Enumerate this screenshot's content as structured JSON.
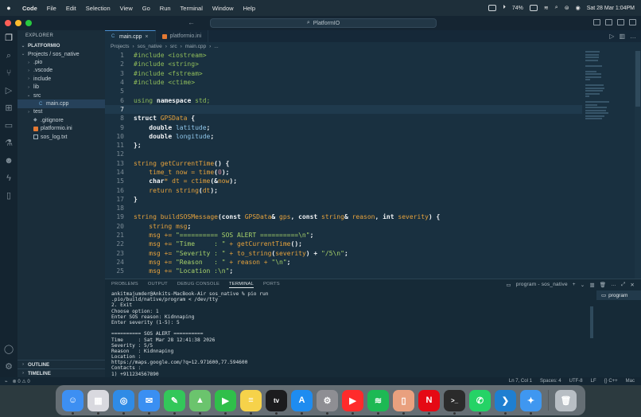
{
  "menubar": {
    "apple": "",
    "items": [
      "Code",
      "File",
      "Edit",
      "Selection",
      "View",
      "Go",
      "Run",
      "Terminal",
      "Window",
      "Help"
    ],
    "battery": "74%",
    "datetime": "Sat 28 Mar  1:04PM"
  },
  "titlebar": {
    "nav": "← →",
    "search": "PlatformIO"
  },
  "sidebar": {
    "header": "EXPLORER",
    "root": "PLATFORMIO",
    "tree": [
      {
        "label": "Projects / sos_native",
        "depth": 0,
        "chevron": "⌄",
        "icon": ""
      },
      {
        "label": ".pio",
        "depth": 1,
        "chevron": "›",
        "icon": ""
      },
      {
        "label": ".vscode",
        "depth": 1,
        "chevron": "›",
        "icon": ""
      },
      {
        "label": "include",
        "depth": 1,
        "chevron": "›",
        "icon": ""
      },
      {
        "label": "lib",
        "depth": 1,
        "chevron": "›",
        "icon": ""
      },
      {
        "label": "src",
        "depth": 1,
        "chevron": "⌄",
        "icon": ""
      },
      {
        "label": "main.cpp",
        "depth": 2,
        "chevron": "",
        "icon": "cpp"
      },
      {
        "label": "test",
        "depth": 1,
        "chevron": "›",
        "icon": ""
      },
      {
        "label": ".gitignore",
        "depth": 1,
        "chevron": "",
        "icon": "git"
      },
      {
        "label": "platformio.ini",
        "depth": 1,
        "chevron": "",
        "icon": "ini"
      },
      {
        "label": "sos_log.txt",
        "depth": 1,
        "chevron": "",
        "icon": "txt"
      }
    ],
    "outline": "OUTLINE",
    "timeline": "TIMELINE"
  },
  "editor": {
    "tabs": [
      {
        "label": "main.cpp",
        "active": true
      },
      {
        "label": "platformio.ini",
        "active": false
      }
    ],
    "breadcrumb": [
      "Projects",
      "sos_native",
      "src",
      "main.cpp",
      "..."
    ],
    "current_line": 7,
    "lines": [
      {
        "n": "1",
        "segs": [
          [
            "pp",
            "#include <iostream>"
          ]
        ]
      },
      {
        "n": "2",
        "segs": [
          [
            "pp",
            "#include <string>"
          ]
        ]
      },
      {
        "n": "3",
        "segs": [
          [
            "pp",
            "#include <fstream>"
          ]
        ]
      },
      {
        "n": "4",
        "segs": [
          [
            "pp",
            "#include <ctime>"
          ]
        ]
      },
      {
        "n": "5",
        "segs": []
      },
      {
        "n": "6",
        "segs": [
          [
            "pp",
            "using "
          ],
          [
            "kw",
            "namespace"
          ],
          [
            "pp",
            " std;"
          ]
        ]
      },
      {
        "n": "7",
        "segs": []
      },
      {
        "n": "8",
        "segs": [
          [
            "kw",
            "struct "
          ],
          [
            "ty",
            "GPSData"
          ],
          [
            "kw",
            " {"
          ]
        ]
      },
      {
        "n": "9",
        "segs": [
          [
            "kw",
            "    double "
          ],
          [
            "var",
            "latitude"
          ],
          [
            "kw",
            ";"
          ]
        ]
      },
      {
        "n": "10",
        "segs": [
          [
            "kw",
            "    double "
          ],
          [
            "var",
            "longitude"
          ],
          [
            "kw",
            ";"
          ]
        ]
      },
      {
        "n": "11",
        "segs": [
          [
            "kw",
            "};"
          ]
        ]
      },
      {
        "n": "12",
        "segs": []
      },
      {
        "n": "13",
        "segs": [
          [
            "fn",
            "string getCurrentTime"
          ],
          [
            "kw",
            "() {"
          ]
        ]
      },
      {
        "n": "14",
        "segs": [
          [
            "fn",
            "    time_t now = time"
          ],
          [
            "kw",
            "("
          ],
          [
            "num",
            "0"
          ],
          [
            "kw",
            ");"
          ]
        ]
      },
      {
        "n": "15",
        "segs": [
          [
            "kw",
            "    char"
          ],
          [
            "fn",
            "* dt = ctime"
          ],
          [
            "kw",
            "(&"
          ],
          [
            "fn",
            "now"
          ],
          [
            "kw",
            ");"
          ]
        ]
      },
      {
        "n": "16",
        "segs": [
          [
            "fn",
            "    return string"
          ],
          [
            "kw",
            "("
          ],
          [
            "fn",
            "dt"
          ],
          [
            "kw",
            ");"
          ]
        ]
      },
      {
        "n": "17",
        "segs": [
          [
            "kw",
            "}"
          ]
        ]
      },
      {
        "n": "18",
        "segs": []
      },
      {
        "n": "19",
        "segs": [
          [
            "fn",
            "string buildSOSMessage"
          ],
          [
            "kw",
            "(const "
          ],
          [
            "ty",
            "GPSData"
          ],
          [
            "kw",
            "& "
          ],
          [
            "fn",
            "gps"
          ],
          [
            "kw",
            ", const "
          ],
          [
            "fn",
            "string"
          ],
          [
            "kw",
            "& "
          ],
          [
            "fn",
            "reason"
          ],
          [
            "kw",
            ", int "
          ],
          [
            "fn",
            "severity"
          ],
          [
            "kw",
            ") {"
          ]
        ]
      },
      {
        "n": "20",
        "segs": [
          [
            "fn",
            "    string msg"
          ],
          [
            "kw",
            ";"
          ]
        ]
      },
      {
        "n": "21",
        "segs": [
          [
            "fn",
            "    msg += "
          ],
          [
            "str",
            "\"========== SOS ALERT ==========\\n\""
          ],
          [
            "kw",
            ";"
          ]
        ]
      },
      {
        "n": "22",
        "segs": [
          [
            "fn",
            "    msg += "
          ],
          [
            "str",
            "\"Time     : \""
          ],
          [
            "fn",
            " + getCurrentTime"
          ],
          [
            "kw",
            "();"
          ]
        ]
      },
      {
        "n": "23",
        "segs": [
          [
            "fn",
            "    msg += "
          ],
          [
            "str",
            "\"Severity : \""
          ],
          [
            "fn",
            " + to_string"
          ],
          [
            "kw",
            "("
          ],
          [
            "fn",
            "severity"
          ],
          [
            "kw",
            ") + "
          ],
          [
            "str",
            "\"/5\\n\""
          ],
          [
            "kw",
            ";"
          ]
        ]
      },
      {
        "n": "24",
        "segs": [
          [
            "fn",
            "    msg += "
          ],
          [
            "str",
            "\"Reason   : \""
          ],
          [
            "fn",
            " + reason + "
          ],
          [
            "str",
            "\"\\n\""
          ],
          [
            "kw",
            ";"
          ]
        ]
      },
      {
        "n": "25",
        "segs": [
          [
            "fn",
            "    msg += "
          ],
          [
            "str",
            "\"Location :\\n\""
          ],
          [
            "kw",
            ";"
          ]
        ]
      }
    ]
  },
  "panel": {
    "tabs": [
      "PROBLEMS",
      "OUTPUT",
      "DEBUG CONSOLE",
      "TERMINAL",
      "PORTS"
    ],
    "active_tab": "TERMINAL",
    "terminal_name": "program - sos_native",
    "terminal_list_item": "program",
    "terminal_lines": [
      "ankitmajumder@Ankits-MacBook-Air sos_native % pio run",
      ".pio/build/native/program < /dev/tty",
      "2. Exit",
      "Choose option: 1",
      "Enter SOS reason: Kidnnaping",
      "Enter severity (1-5): 5",
      "",
      "========== SOS ALERT ==========",
      "Time     : Sat Mar 28 12:41:38 2026",
      "Severity : 5/5",
      "Reason   : Kidnnaping",
      "Location :",
      "https://maps.google.com/?q=12.971600,77.594600",
      "Contacts :",
      "1) +911234567890",
      "2) +112"
    ]
  },
  "statusbar": {
    "left": [
      "⊗ 0 ⚠ 0"
    ],
    "right": [
      "Ln 7, Col 1",
      "Spaces: 4",
      "UTF-8",
      "LF",
      "{} C++",
      "Mac"
    ]
  },
  "dock": {
    "apps": [
      {
        "name": "finder",
        "color": "#3d8ff2",
        "glyph": "☺"
      },
      {
        "name": "launchpad",
        "color": "#d9d9df",
        "glyph": "▦"
      },
      {
        "name": "safari",
        "color": "#2f8be6",
        "glyph": "◎"
      },
      {
        "name": "mail",
        "color": "#3a8ff2",
        "glyph": "✉"
      },
      {
        "name": "messages",
        "color": "#33c75a",
        "glyph": "✎"
      },
      {
        "name": "maps",
        "color": "#6bc46d",
        "glyph": "▲"
      },
      {
        "name": "facetime",
        "color": "#2fbf4a",
        "glyph": "▶"
      },
      {
        "name": "notes",
        "color": "#f6d24a",
        "glyph": "≡"
      },
      {
        "name": "tv",
        "color": "#1c1c1e",
        "glyph": "tv"
      },
      {
        "name": "app-store",
        "color": "#1e8cf0",
        "glyph": "A"
      },
      {
        "name": "system-settings",
        "color": "#8e8e93",
        "glyph": "⚙"
      },
      {
        "name": "youtube",
        "color": "#ff2b2b",
        "glyph": "▶"
      },
      {
        "name": "spotify",
        "color": "#1db954",
        "glyph": "≋"
      },
      {
        "name": "iphone-mirroring",
        "color": "#e9a07e",
        "glyph": "▯"
      },
      {
        "name": "netflix",
        "color": "#e50914",
        "glyph": "N"
      },
      {
        "name": "terminal",
        "color": "#2b2b2b",
        "glyph": ">_"
      },
      {
        "name": "whatsapp",
        "color": "#25d366",
        "glyph": "✆"
      },
      {
        "name": "vscode",
        "color": "#1f7fd1",
        "glyph": "❯"
      },
      {
        "name": "xcode",
        "color": "#3f97f0",
        "glyph": "✦"
      },
      {
        "name": "trash",
        "color": "#b8bec4",
        "glyph": "🗑"
      }
    ]
  }
}
